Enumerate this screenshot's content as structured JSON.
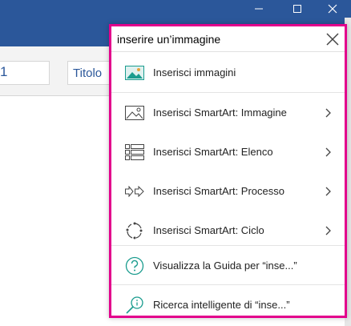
{
  "window": {
    "controls": [
      "minimize-icon",
      "maximize-icon",
      "close-icon"
    ]
  },
  "ribbon": {
    "font_size_value": "1",
    "style_label": "Titolo"
  },
  "search": {
    "query": "inserire un’immagine"
  },
  "menu": {
    "items": [
      {
        "label": "Inserisci immagini",
        "icon": "image-icon",
        "has_submenu": false
      },
      {
        "label": "Inserisci SmartArt: Immagine",
        "icon": "smartart-picture-icon",
        "has_submenu": true
      },
      {
        "label": "Inserisci SmartArt: Elenco",
        "icon": "smartart-list-icon",
        "has_submenu": true
      },
      {
        "label": "Inserisci SmartArt: Processo",
        "icon": "smartart-process-icon",
        "has_submenu": true
      },
      {
        "label": "Inserisci SmartArt: Ciclo",
        "icon": "smartart-cycle-icon",
        "has_submenu": true
      }
    ],
    "help_label": "Visualizza la Guida per “inse...”",
    "smart_lookup_label": "Ricerca intelligente di “inse...”"
  },
  "colors": {
    "accent": "#2b579a",
    "highlight_border": "#e3008c",
    "icon_teal": "#1a9c8e"
  }
}
